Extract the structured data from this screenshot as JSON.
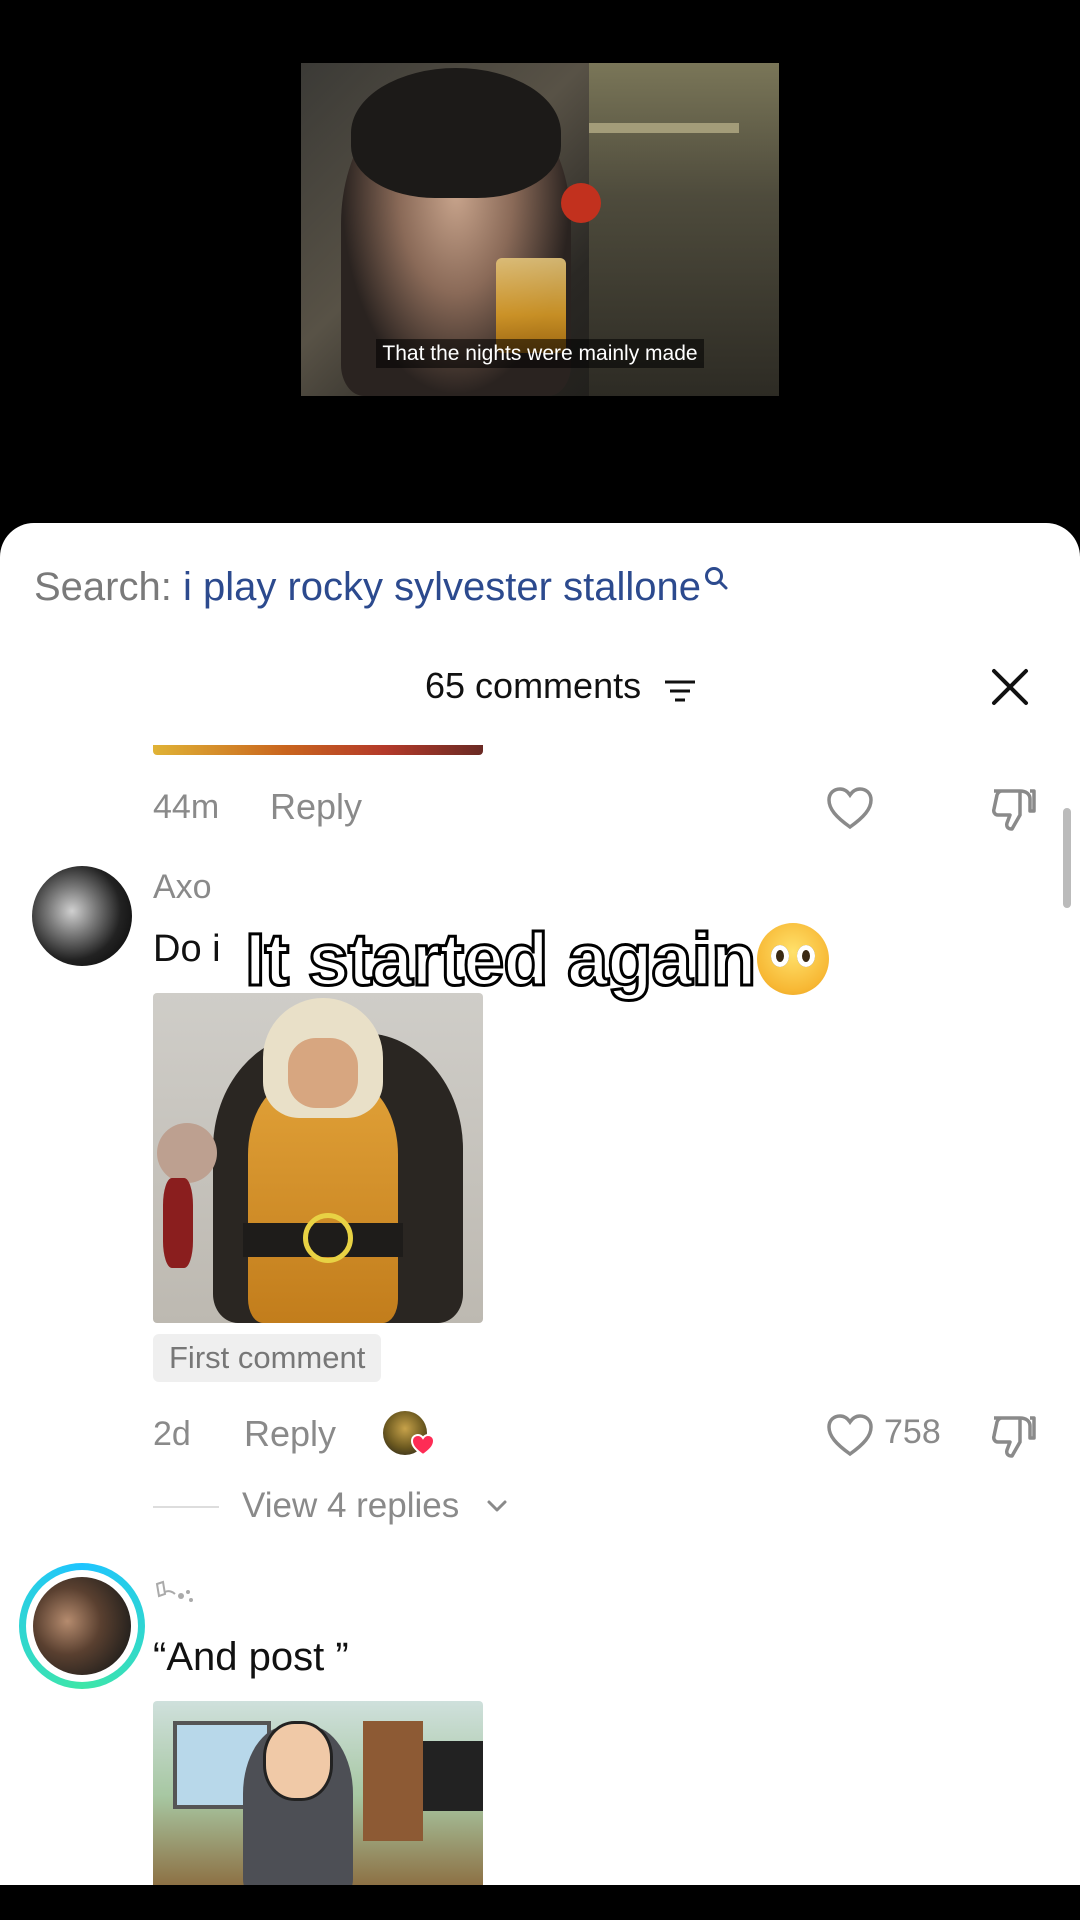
{
  "video": {
    "subtitle": "That the nights were mainly made"
  },
  "search": {
    "prefix": "Search:",
    "query": "i play rocky sylvester stallone",
    "icon": "search-icon"
  },
  "comments_header": {
    "count_label": "65 comments",
    "filter_icon": "filter-icon",
    "close_icon": "close-icon"
  },
  "overlay_caption": {
    "text": "It started again",
    "emoji": "pleading-face-emoji"
  },
  "comments": [
    {
      "time": "44m",
      "reply_label": "Reply"
    },
    {
      "author": "Axo",
      "text": "Do i",
      "badge": "First comment",
      "time": "2d",
      "reply_label": "Reply",
      "likes": "758",
      "view_replies": "View 4 replies"
    },
    {
      "text": "“And post ”"
    }
  ],
  "colors": {
    "query_blue": "#2c4a8e",
    "muted_gray": "#8a8a8a",
    "ring_start": "#1ec4ff",
    "ring_end": "#3ee6a8",
    "liker_heart": "#fe2c55"
  }
}
